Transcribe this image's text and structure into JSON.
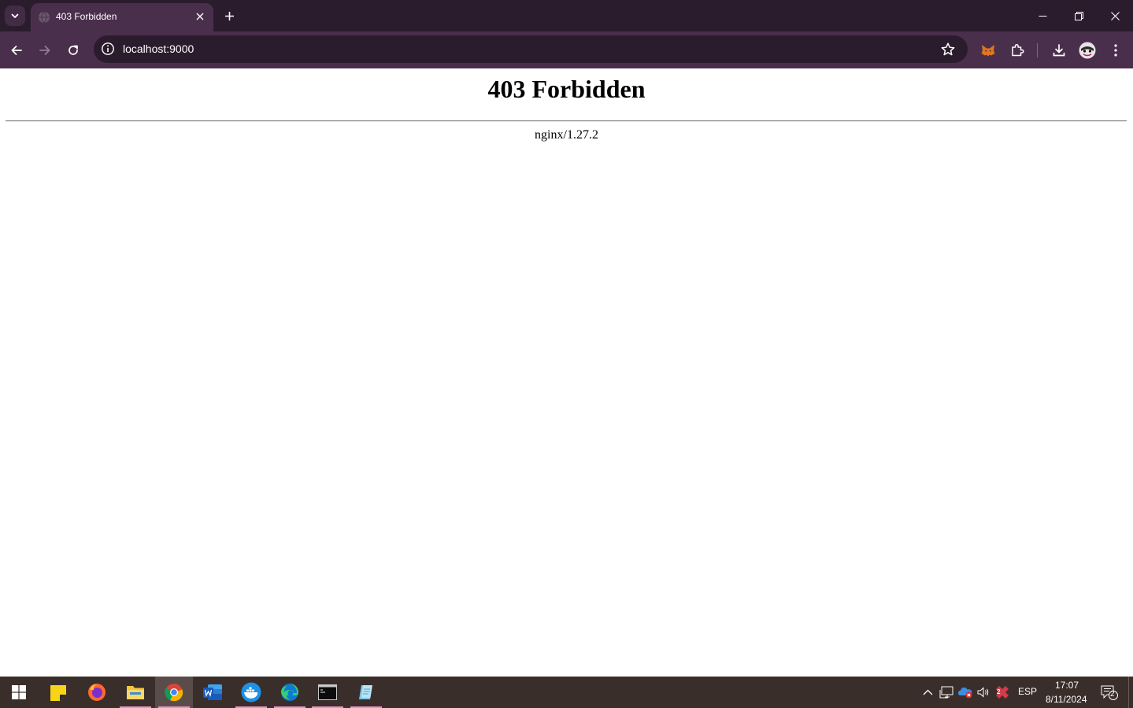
{
  "browser": {
    "tab": {
      "title": "403 Forbidden"
    },
    "address_bar": {
      "url": "localhost:9000"
    }
  },
  "page": {
    "heading": "403 Forbidden",
    "server_signature": "nginx/1.27.2"
  },
  "taskbar": {
    "apps": [
      {
        "name": "Sticky Notes",
        "running": false
      },
      {
        "name": "Firefox",
        "running": false
      },
      {
        "name": "File Explorer",
        "running": true
      },
      {
        "name": "Chrome",
        "running": true,
        "active": true
      },
      {
        "name": "Word",
        "running": false
      },
      {
        "name": "Docker",
        "running": true
      },
      {
        "name": "Edge",
        "running": true
      },
      {
        "name": "Terminal",
        "running": true
      },
      {
        "name": "Notes app",
        "running": true
      }
    ],
    "tray": {
      "language": "ESP",
      "time": "17:07",
      "date": "8/11/2024",
      "notification_count": "2",
      "badge_count": "2"
    }
  },
  "colors": {
    "tabstrip": "#2b1c2d",
    "toolbar": "#4a2f4c",
    "taskbar": "#3a2e2b",
    "running_indicator": "#e793c4"
  }
}
